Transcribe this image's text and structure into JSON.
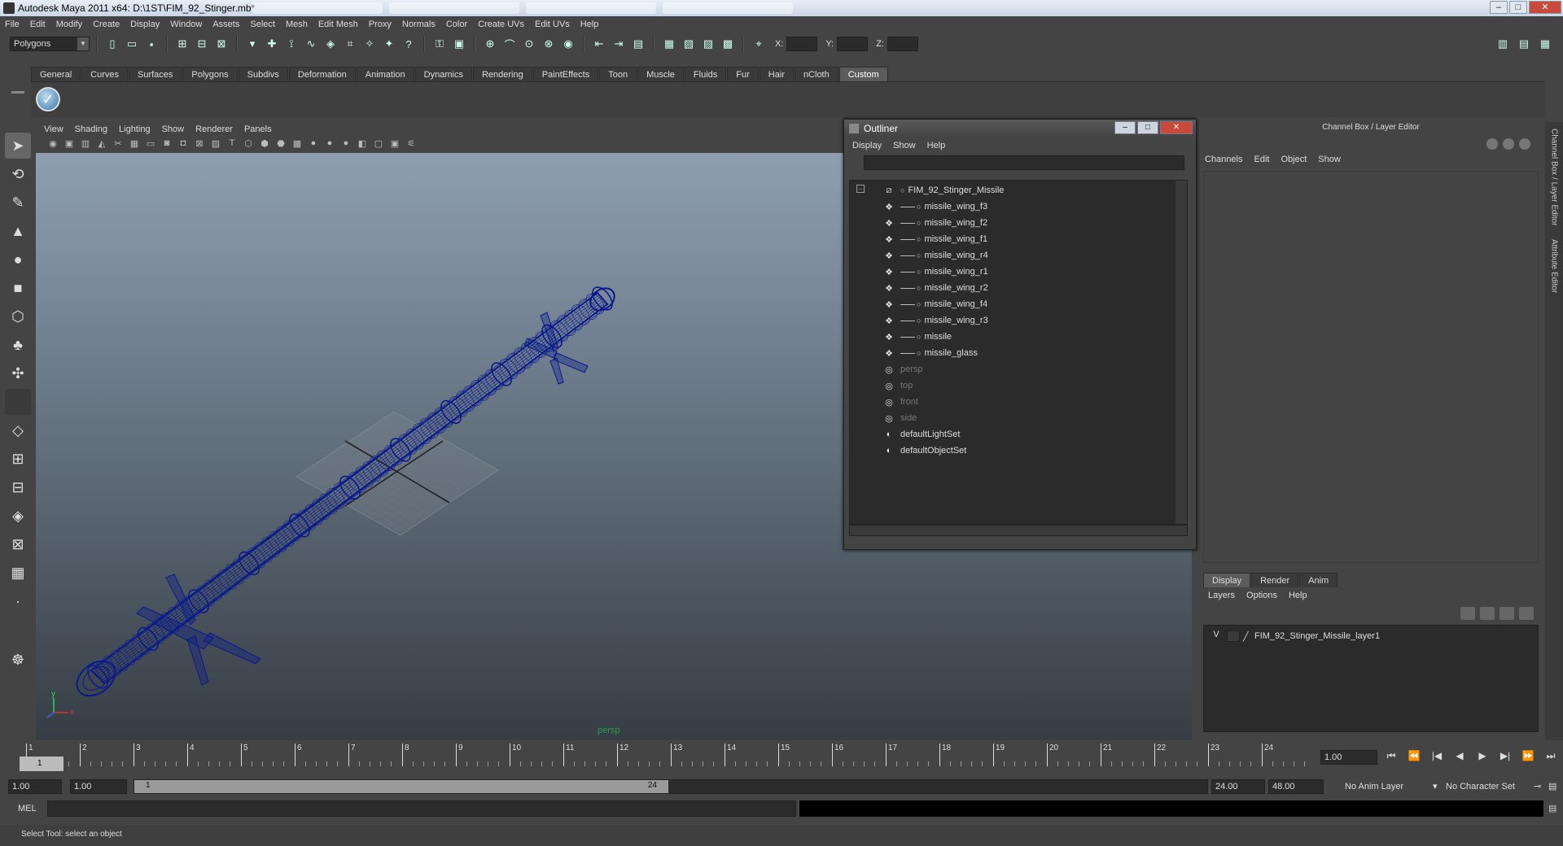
{
  "window": {
    "title": "Autodesk Maya 2011 x64: D:\\1ST\\FIM_92_Stinger.mb*",
    "min": "–",
    "max": "□",
    "close": "✕"
  },
  "menubar": [
    "File",
    "Edit",
    "Modify",
    "Create",
    "Display",
    "Window",
    "Assets",
    "Select",
    "Mesh",
    "Edit Mesh",
    "Proxy",
    "Normals",
    "Color",
    "Create UVs",
    "Edit UVs",
    "Help"
  ],
  "statusline": {
    "mode": "Polygons",
    "x_label": "X:",
    "y_label": "Y:",
    "z_label": "Z:"
  },
  "shelf": {
    "tabs": [
      "General",
      "Curves",
      "Surfaces",
      "Polygons",
      "Subdivs",
      "Deformation",
      "Animation",
      "Dynamics",
      "Rendering",
      "PaintEffects",
      "Toon",
      "Muscle",
      "Fluids",
      "Fur",
      "Hair",
      "nCloth",
      "Custom"
    ],
    "active_tab": "Custom",
    "icon": "checkmark-icon"
  },
  "viewport": {
    "menu": [
      "View",
      "Shading",
      "Lighting",
      "Show",
      "Renderer",
      "Panels"
    ],
    "camera_label": "persp",
    "axis_y": "y",
    "axis_x": "x",
    "wire_color": "#0a1a8c"
  },
  "outliner": {
    "title": "Outliner",
    "menu": [
      "Display",
      "Show",
      "Help"
    ],
    "root": "FIM_92_Stinger_Missile",
    "children": [
      "missile_wing_f3",
      "missile_wing_f2",
      "missile_wing_f1",
      "missile_wing_r4",
      "missile_wing_r1",
      "missile_wing_r2",
      "missile_wing_f4",
      "missile_wing_r3",
      "missile",
      "missile_glass"
    ],
    "cameras": [
      "persp",
      "top",
      "front",
      "side"
    ],
    "sets": [
      "defaultLightSet",
      "defaultObjectSet"
    ],
    "collapse_symbol": "–"
  },
  "channelbox": {
    "title": "Channel Box / Layer Editor",
    "menu": [
      "Channels",
      "Edit",
      "Object",
      "Show"
    ],
    "layer_tabs": [
      "Display",
      "Render",
      "Anim"
    ],
    "active_layer_tab": "Display",
    "layer_menu": [
      "Layers",
      "Options",
      "Help"
    ],
    "layer": {
      "visible": "V",
      "name": "FIM_92_Stinger_Missile_layer1"
    }
  },
  "side_tabs": [
    "Channel Box / Layer Editor",
    "Attribute Editor"
  ],
  "timeslider": {
    "frames": [
      "1",
      "2",
      "3",
      "4",
      "5",
      "6",
      "7",
      "8",
      "9",
      "10",
      "11",
      "12",
      "13",
      "14",
      "15",
      "16",
      "17",
      "18",
      "19",
      "20",
      "21",
      "22",
      "23",
      "24"
    ],
    "current_frame": "1",
    "current_time_field": "1.00"
  },
  "playback": [
    "⏮",
    "⏪",
    "|◀",
    "◀",
    "▶",
    "▶|",
    "⏩",
    "⏭"
  ],
  "range": {
    "start_time": "1.00",
    "playback_start": "1.00",
    "handle_start": "1",
    "handle_end": "24",
    "playback_end": "24.00",
    "end_time": "48.00",
    "anim_layer": "No Anim Layer",
    "character_set": "No Character Set"
  },
  "cmdline": {
    "label": "MEL"
  },
  "helpline": {
    "text": "Select Tool: select an object"
  }
}
